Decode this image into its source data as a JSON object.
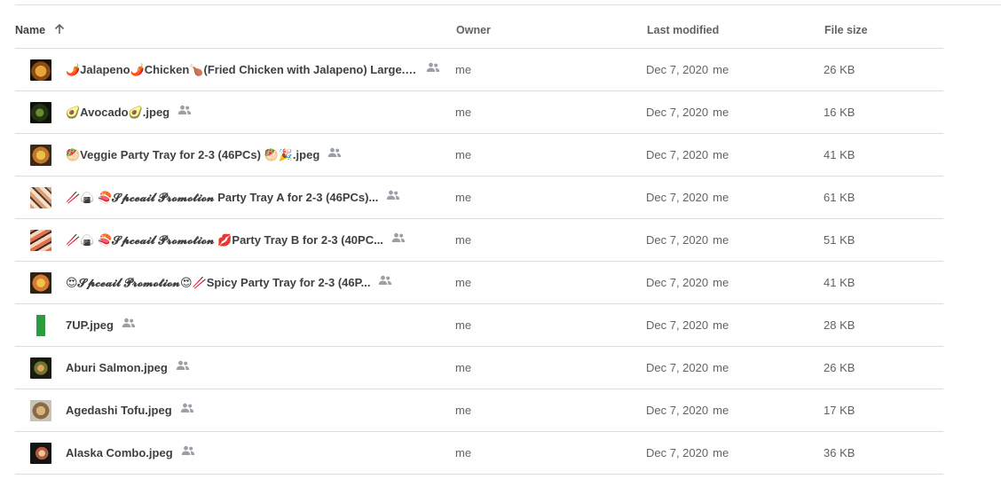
{
  "header": {
    "name_label": "Name",
    "owner_label": "Owner",
    "modified_label": "Last modified",
    "size_label": "File size",
    "sort_icon": "arrow-up-icon"
  },
  "files": [
    {
      "name": "🌶️Jalapeno🌶️Chicken🍗(Fried Chicken with Jalapeno) Large.jpeg",
      "owner": "me",
      "modified": "Dec 7, 2020",
      "modified_by": "me",
      "size": "26 KB",
      "thumb": "t-fried"
    },
    {
      "name": "🥑Avocado🥑.jpeg",
      "owner": "me",
      "modified": "Dec 7, 2020",
      "modified_by": "me",
      "size": "16 KB",
      "thumb": "t-avocado"
    },
    {
      "name": "🥙Veggie Party Tray for 2-3 (46PCs) 🥙🎉.jpeg",
      "owner": "me",
      "modified": "Dec 7, 2020",
      "modified_by": "me",
      "size": "41 KB",
      "thumb": "t-veggie"
    },
    {
      "name": "🥢🍙 🍣𝓢𝓹𝓬𝓮𝓪𝓲𝓵 𝓟𝓻𝓸𝓶𝓸𝓽𝓲𝓸𝓷 Party Tray A for 2-3 (46PCs)...",
      "owner": "me",
      "modified": "Dec 7, 2020",
      "modified_by": "me",
      "size": "61 KB",
      "thumb": "t-trayA"
    },
    {
      "name": "🥢🍙 🍣𝓢𝓹𝓬𝓮𝓪𝓲𝓵 𝓟𝓻𝓸𝓶𝓸𝓽𝓲𝓸𝓷 💋Party Tray B for 2-3 (40PC...",
      "owner": "me",
      "modified": "Dec 7, 2020",
      "modified_by": "me",
      "size": "51 KB",
      "thumb": "t-trayB"
    },
    {
      "name": "😍𝓢𝓹𝓬𝓮𝓪𝓲𝓵 𝓟𝓻𝓸𝓶𝓸𝓽𝓲𝓸𝓷😍🥢Spicy Party Tray for 2-3  (46P...",
      "owner": "me",
      "modified": "Dec 7, 2020",
      "modified_by": "me",
      "size": "41 KB",
      "thumb": "t-spicy"
    },
    {
      "name": "7UP.jpeg",
      "owner": "me",
      "modified": "Dec 7, 2020",
      "modified_by": "me",
      "size": "28 KB",
      "thumb": "t-7up"
    },
    {
      "name": "Aburi Salmon.jpeg",
      "owner": "me",
      "modified": "Dec 7, 2020",
      "modified_by": "me",
      "size": "26 KB",
      "thumb": "t-salmon"
    },
    {
      "name": "Agedashi Tofu.jpeg",
      "owner": "me",
      "modified": "Dec 7, 2020",
      "modified_by": "me",
      "size": "17 KB",
      "thumb": "t-tofu"
    },
    {
      "name": "Alaska Combo.jpeg",
      "owner": "me",
      "modified": "Dec 7, 2020",
      "modified_by": "me",
      "size": "36 KB",
      "thumb": "t-alaska"
    }
  ],
  "icons": {
    "shared": "people-icon",
    "thumbnail": "image-thumbnail"
  }
}
